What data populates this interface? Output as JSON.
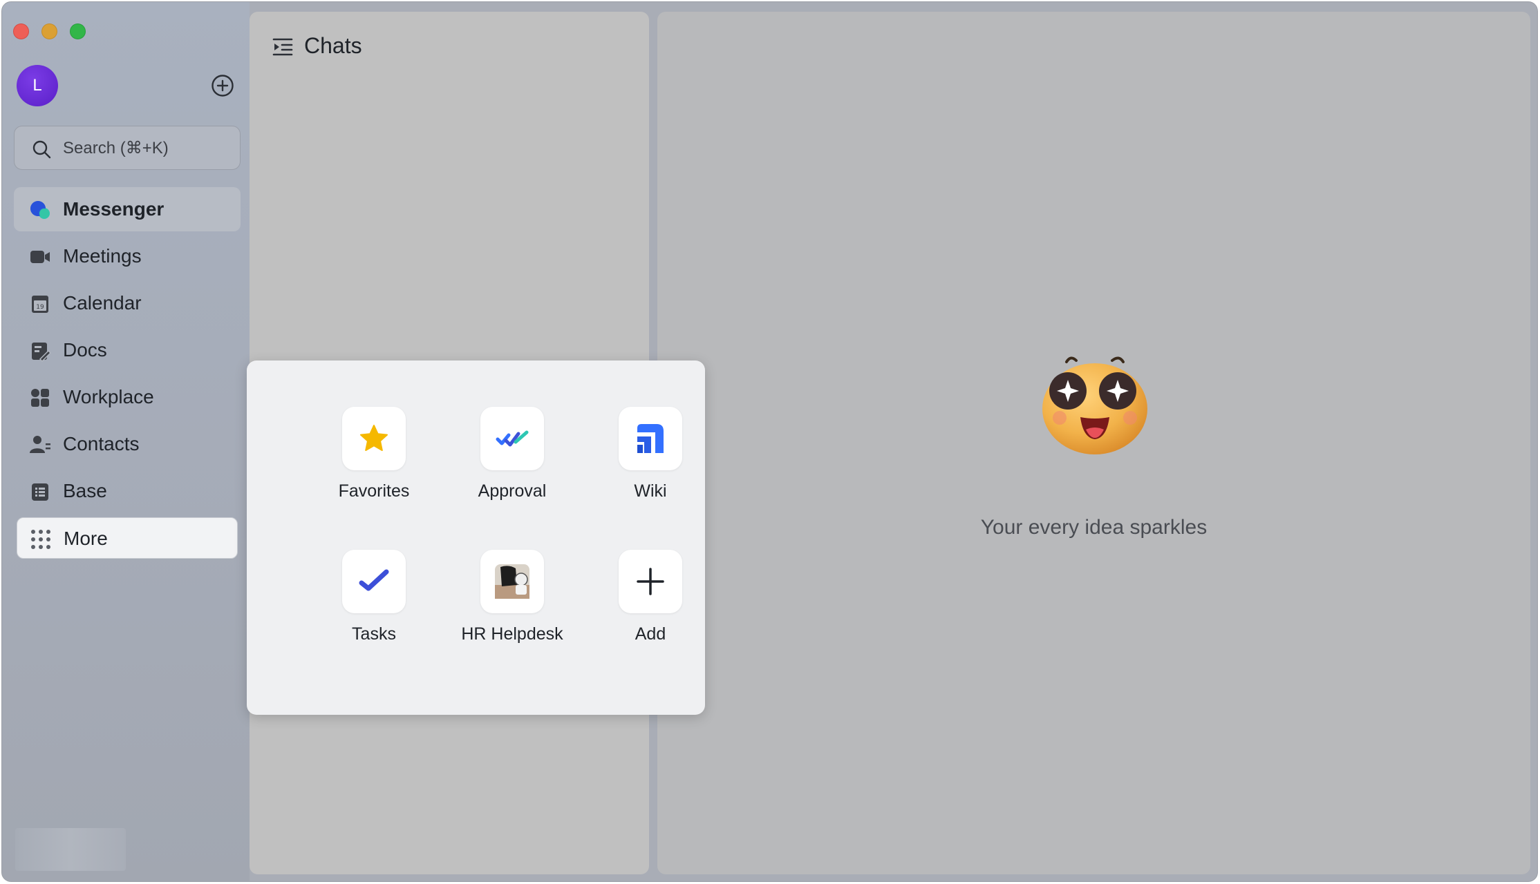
{
  "window": {
    "controls": [
      "close",
      "minimize",
      "zoom"
    ]
  },
  "sidebar": {
    "avatar_initial": "L",
    "search_placeholder": "Search (⌘+K)",
    "items": [
      {
        "label": "Messenger",
        "icon": "messenger-icon",
        "active": true
      },
      {
        "label": "Meetings",
        "icon": "video-camera-icon"
      },
      {
        "label": "Calendar",
        "icon": "calendar-icon"
      },
      {
        "label": "Docs",
        "icon": "docs-icon"
      },
      {
        "label": "Workplace",
        "icon": "workplace-icon"
      },
      {
        "label": "Contacts",
        "icon": "contacts-icon"
      },
      {
        "label": "Base",
        "icon": "base-icon"
      },
      {
        "label": "More",
        "icon": "more-grid-icon",
        "hovered": true
      }
    ]
  },
  "chats": {
    "title": "Chats"
  },
  "main": {
    "tagline": "Your every idea sparkles"
  },
  "more_popup": {
    "apps": [
      {
        "label": "Favorites",
        "icon": "star-icon"
      },
      {
        "label": "Approval",
        "icon": "approval-icon"
      },
      {
        "label": "Wiki",
        "icon": "wiki-icon"
      },
      {
        "label": "Tasks",
        "icon": "tasks-check-icon"
      },
      {
        "label": "HR Helpdesk",
        "icon": "hr-helpdesk-icon"
      },
      {
        "label": "Add",
        "icon": "plus-icon"
      }
    ]
  },
  "colors": {
    "accent_blue": "#3370ff",
    "avatar_purple": "#6a2ad8",
    "star_yellow": "#f5b800",
    "approval_teal": "#2ec7b3"
  }
}
